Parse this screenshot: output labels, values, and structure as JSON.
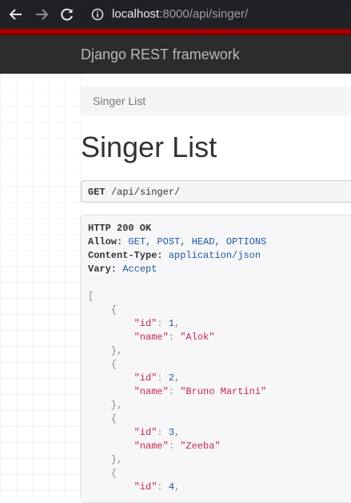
{
  "browser": {
    "url_host": "localhost",
    "url_rest": ":8000/api/singer/"
  },
  "navbar": {
    "brand": "Django REST framework"
  },
  "breadcrumb": {
    "item": "Singer List"
  },
  "page": {
    "title": "Singer List"
  },
  "request": {
    "method": "GET",
    "path": "/api/singer/"
  },
  "response": {
    "status": "HTTP 200 OK",
    "headers": [
      {
        "key": "Allow:",
        "value": "GET, POST, HEAD, OPTIONS"
      },
      {
        "key": "Content-Type:",
        "value": "application/json"
      },
      {
        "key": "Vary:",
        "value": "Accept"
      }
    ],
    "items": [
      {
        "id_key": "\"id\"",
        "id": "1",
        "name_key": "\"name\"",
        "name": "\"Alok\""
      },
      {
        "id_key": "\"id\"",
        "id": "2",
        "name_key": "\"name\"",
        "name": "\"Bruno Martini\""
      },
      {
        "id_key": "\"id\"",
        "id": "3",
        "name_key": "\"name\"",
        "name": "\"Zeeba\""
      },
      {
        "id_key": "\"id\"",
        "id": "4"
      }
    ]
  },
  "colors": {
    "chrome": "#202124",
    "accent_red": "#a30000",
    "navbar": "#2c2c2c",
    "json_string": "#c7254e",
    "json_number": "#1f57a3"
  },
  "icons": [
    "back-arrow-icon",
    "forward-arrow-icon",
    "reload-icon",
    "info-icon"
  ]
}
